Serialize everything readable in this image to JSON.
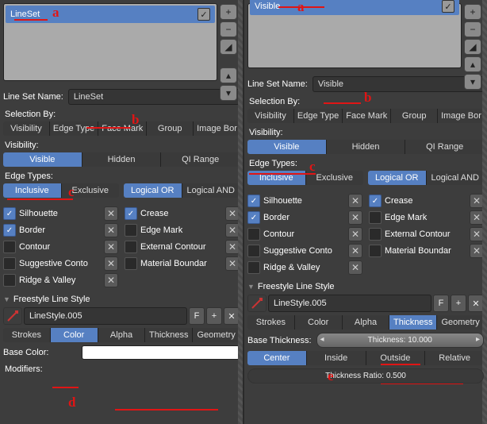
{
  "left": {
    "list_item": "LineSet",
    "name_label": "Line Set Name:",
    "name_value": "LineSet",
    "selection_by": "Selection By:",
    "sel_tabs": [
      "Visibility",
      "Edge Type",
      "Face Mark",
      "Group",
      "Image Bor"
    ],
    "visibility": "Visibility:",
    "vis_tabs": [
      "Visible",
      "Hidden",
      "QI Range"
    ],
    "edge_types": "Edge Types:",
    "incl_excl": [
      "Inclusive",
      "Exclusive"
    ],
    "logical": [
      "Logical OR",
      "Logical AND"
    ],
    "edges_l": [
      {
        "label": "Silhouette",
        "on": true
      },
      {
        "label": "Border",
        "on": true
      },
      {
        "label": "Contour",
        "on": false
      },
      {
        "label": "Suggestive Conto",
        "on": false
      },
      {
        "label": "Ridge & Valley",
        "on": false
      }
    ],
    "edges_r": [
      {
        "label": "Crease",
        "on": true
      },
      {
        "label": "Edge Mark",
        "on": false
      },
      {
        "label": "External Contour",
        "on": false
      },
      {
        "label": "Material Boundar",
        "on": false
      }
    ],
    "linestyle_hdr": "Freestyle Line Style",
    "linestyle_id": "LineStyle.005",
    "linestyle_f": "F",
    "style_tabs": [
      "Strokes",
      "Color",
      "Alpha",
      "Thickness",
      "Geometry"
    ],
    "basecolor": "Base Color:",
    "modifiers": "Modifiers:"
  },
  "right": {
    "visible_label": "Visible",
    "name_label": "Line Set Name:",
    "name_value": "Visible",
    "selection_by": "Selection By:",
    "sel_tabs": [
      "Visibility",
      "Edge Type",
      "Face Mark",
      "Group",
      "Image Bor"
    ],
    "visibility": "Visibility:",
    "vis_tabs": [
      "Visible",
      "Hidden",
      "QI Range"
    ],
    "edge_types": "Edge Types:",
    "incl_excl": [
      "Inclusive",
      "Exclusive"
    ],
    "logical": [
      "Logical OR",
      "Logical AND"
    ],
    "edges_l": [
      {
        "label": "Silhouette",
        "on": true
      },
      {
        "label": "Border",
        "on": true
      },
      {
        "label": "Contour",
        "on": false
      },
      {
        "label": "Suggestive Conto",
        "on": false
      },
      {
        "label": "Ridge & Valley",
        "on": false
      }
    ],
    "edges_r": [
      {
        "label": "Crease",
        "on": true
      },
      {
        "label": "Edge Mark",
        "on": false
      },
      {
        "label": "External Contour",
        "on": false
      },
      {
        "label": "Material Boundar",
        "on": false
      }
    ],
    "linestyle_hdr": "Freestyle Line Style",
    "linestyle_id": "LineStyle.005",
    "linestyle_f": "F",
    "style_tabs": [
      "Strokes",
      "Color",
      "Alpha",
      "Thickness",
      "Geometry"
    ],
    "basethickness": "Base Thickness:",
    "thickness_val": "Thickness: 10.000",
    "center_tabs": [
      "Center",
      "Inside",
      "Outside",
      "Relative"
    ],
    "ratio": "Thickness Ratio: 0.500"
  },
  "annotations": {
    "a": "a",
    "b": "b",
    "c": "c",
    "d": "d",
    "e": "e"
  }
}
